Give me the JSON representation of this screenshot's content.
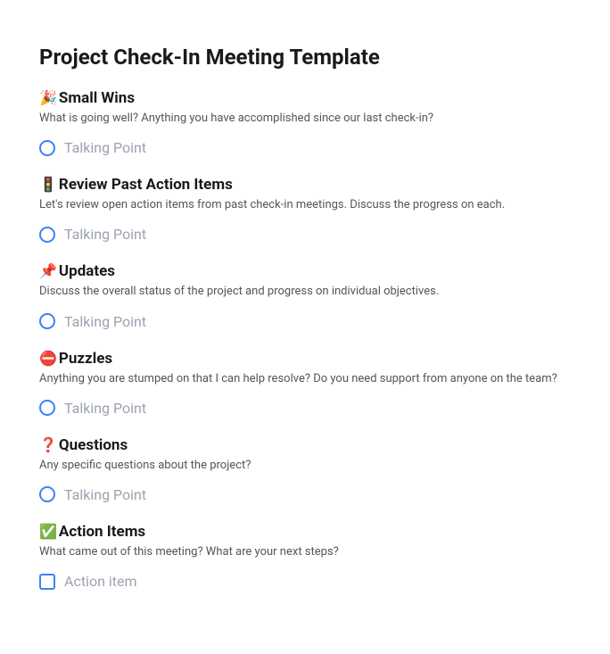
{
  "title": "Project Check-In Meeting Template",
  "sections": [
    {
      "emoji": "🎉",
      "title": "Small Wins",
      "desc": "What is going well? Anything you have accomplished since our last check-in?",
      "placeholder": "Talking Point",
      "shape": "circle"
    },
    {
      "emoji": "🚦",
      "title": "Review Past Action Items",
      "desc": "Let's review open action items from past check-in meetings. Discuss the progress on each.",
      "placeholder": "Talking Point",
      "shape": "circle"
    },
    {
      "emoji": "📌",
      "title": "Updates",
      "desc": "Discuss the overall status of the project and progress on individual objectives.",
      "placeholder": "Talking Point",
      "shape": "circle"
    },
    {
      "emoji": "⛔",
      "title": "Puzzles",
      "desc": "Anything you are stumped on that I can help resolve? Do you need support from anyone on the team?",
      "placeholder": "Talking Point",
      "shape": "circle"
    },
    {
      "emoji": "❓",
      "title": "Questions",
      "desc": "Any specific questions about the project?",
      "placeholder": "Talking Point",
      "shape": "circle"
    },
    {
      "emoji": "✅",
      "title": "Action Items",
      "desc": "What came out of this meeting? What are your next steps?",
      "placeholder": "Action item",
      "shape": "square"
    }
  ]
}
